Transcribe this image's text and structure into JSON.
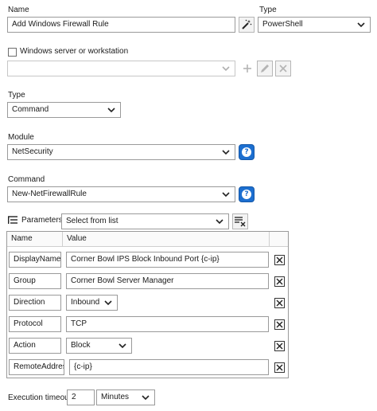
{
  "name_label": "Name",
  "name_value": "Add Windows Firewall Rule",
  "type_label_top": "Type",
  "type_top_value": "PowerShell",
  "server_checkbox_label": "Windows server or workstation",
  "server_value": "",
  "type_label": "Type",
  "type_value": "Command",
  "module_label": "Module",
  "module_value": "NetSecurity",
  "command_label": "Command",
  "command_value": "New-NetFirewallRule",
  "parameters_label": "Parameters",
  "parameters_select_value": "Select from list",
  "help_glyph": "?",
  "table": {
    "col_name": "Name",
    "col_value": "Value",
    "rows": [
      {
        "name": "DisplayName",
        "value": "Corner Bowl IPS Block Inbound Port {c-ip}"
      },
      {
        "name": "Group",
        "value": "Corner Bowl Server Manager"
      },
      {
        "name": "Direction",
        "value": "Inbound"
      },
      {
        "name": "Protocol",
        "value": "TCP"
      },
      {
        "name": "Action",
        "value": "Block"
      },
      {
        "name": "RemoteAddress",
        "value": "{c-ip}"
      }
    ]
  },
  "timeout_label": "Execution timeout",
  "timeout_value": "2",
  "timeout_unit": "Minutes",
  "colors": {
    "accent": "#1c6fd0",
    "border": "#9a9a9a"
  }
}
